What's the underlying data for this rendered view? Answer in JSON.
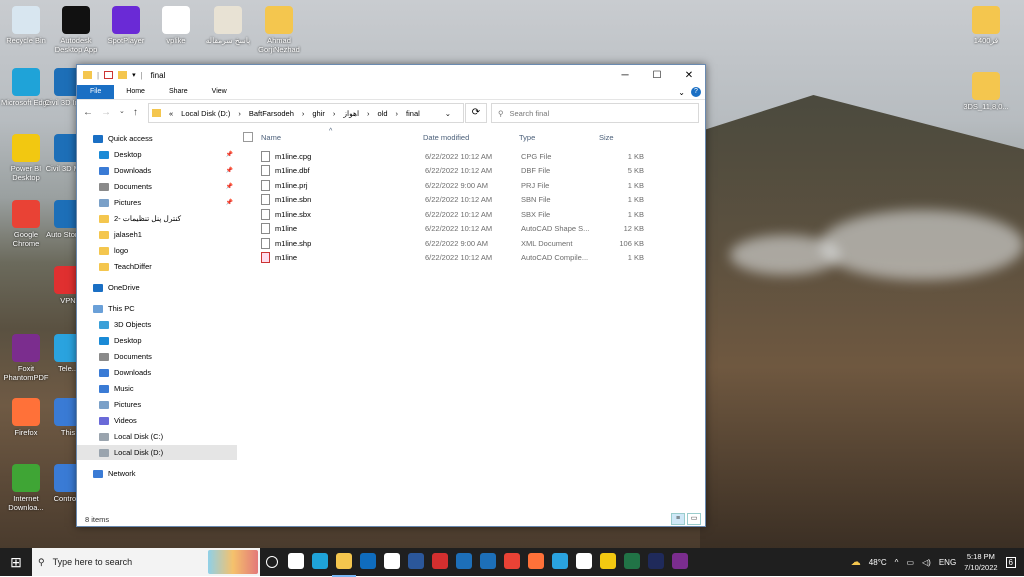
{
  "desktop": {
    "icons_left": [
      {
        "label": "Recycle Bin",
        "color": "#d8e6f0"
      },
      {
        "label": "Autodesk Desktop App",
        "color": "#111111"
      },
      {
        "label": "SpotPlayer",
        "color": "#6a2ad6"
      },
      {
        "label": "vplike",
        "color": "#ffffff"
      },
      {
        "label": "پاسخ سرمقاله",
        "color": "#e8e2d4"
      },
      {
        "label": "Ahmad GorjiNezhad",
        "color": "#f4c64e"
      }
    ],
    "icons_col": [
      {
        "label": "Microsoft Edge",
        "color": "#1fa3d8"
      },
      {
        "label": "Power BI Desktop",
        "color": "#f2c811"
      },
      {
        "label": "Google Chrome",
        "color": "#e94235"
      },
      {
        "label": "Foxit PhantomPDF",
        "color": "#7b2d8e"
      },
      {
        "label": "Firefox",
        "color": "#ff7139"
      },
      {
        "label": "Internet Downloa...",
        "color": "#3fa535"
      }
    ],
    "icons_col2": [
      {
        "label": "Civil 3D Imp...",
        "color": "#1d6fb8"
      },
      {
        "label": "Civil 3D Me...",
        "color": "#1d6fb8"
      },
      {
        "label": "Auto Storm...",
        "color": "#1d6fb8"
      },
      {
        "label": "VPN",
        "color": "#e03030"
      },
      {
        "label": "Tele...",
        "color": "#2aa3df"
      },
      {
        "label": "This",
        "color": "#3a7bd5"
      },
      {
        "label": "Contro...",
        "color": "#3a7bd5"
      }
    ],
    "icons_right": [
      {
        "label": "فر1400",
        "color": "#f4c64e"
      },
      {
        "label": "3DS_11,8,0...",
        "color": "#f4c64e"
      }
    ]
  },
  "window": {
    "title": "final",
    "minimize": "─",
    "maximize": "☐",
    "close": "✕",
    "ribbon_tabs": [
      "File",
      "Home",
      "Share",
      "View"
    ],
    "help": "?",
    "expand": "⌄",
    "address": {
      "lead": "«",
      "segments": [
        "Local Disk (D:)",
        "BaftFarsodeh",
        "ghir",
        "اهواز",
        "old",
        "final"
      ],
      "separator": "›"
    },
    "search_placeholder": "Search final",
    "nav": {
      "quick_access": "Quick access",
      "items_quick": [
        "Desktop",
        "Downloads",
        "Documents",
        "Pictures",
        "کنترل پنل تنظیمات -2",
        "jalaseh1",
        "logo",
        "TeachDiffer"
      ],
      "onedrive": "OneDrive",
      "this_pc": "This PC",
      "items_pc": [
        "3D Objects",
        "Desktop",
        "Documents",
        "Downloads",
        "Music",
        "Pictures",
        "Videos",
        "Local Disk (C:)",
        "Local Disk (D:)"
      ],
      "network": "Network"
    },
    "columns": {
      "name": "Name",
      "date": "Date modified",
      "type": "Type",
      "size": "Size"
    },
    "files": [
      {
        "name": "m1line.cpg",
        "date": "6/22/2022 10:12 AM",
        "type": "CPG File",
        "size": "1 KB"
      },
      {
        "name": "m1line.dbf",
        "date": "6/22/2022 10:12 AM",
        "type": "DBF File",
        "size": "5 KB"
      },
      {
        "name": "m1line.prj",
        "date": "6/22/2022 9:00 AM",
        "type": "PRJ File",
        "size": "1 KB"
      },
      {
        "name": "m1line.sbn",
        "date": "6/22/2022 10:12 AM",
        "type": "SBN File",
        "size": "1 KB"
      },
      {
        "name": "m1line.sbx",
        "date": "6/22/2022 10:12 AM",
        "type": "SBX File",
        "size": "1 KB"
      },
      {
        "name": "m1line",
        "date": "6/22/2022 10:12 AM",
        "type": "AutoCAD Shape S...",
        "size": "12 KB"
      },
      {
        "name": "m1line.shp",
        "date": "6/22/2022 9:00 AM",
        "type": "XML Document",
        "size": "106 KB"
      },
      {
        "name": "m1line",
        "date": "6/22/2022 10:12 AM",
        "type": "AutoCAD Compile...",
        "size": "1 KB"
      }
    ],
    "status": "8 items"
  },
  "taskbar": {
    "start": "⊞",
    "search_placeholder": "Type here to search",
    "weather": "48°C",
    "lang": "ENG",
    "time": "5:18 PM",
    "date": "7/10/2022",
    "notif_count": "6",
    "apps": [
      "#ffffff",
      "#1fa3d8",
      "#f4c64e",
      "#0f6cbd",
      "#ffffff",
      "#2b579a",
      "#d32f2f",
      "#1d6fb8",
      "#1d6fb8",
      "#e94235",
      "#ff7139",
      "#2aa3df",
      "#ffffff",
      "#f2c811",
      "#217346",
      "#1f2a5a",
      "#7b2d8e"
    ]
  }
}
